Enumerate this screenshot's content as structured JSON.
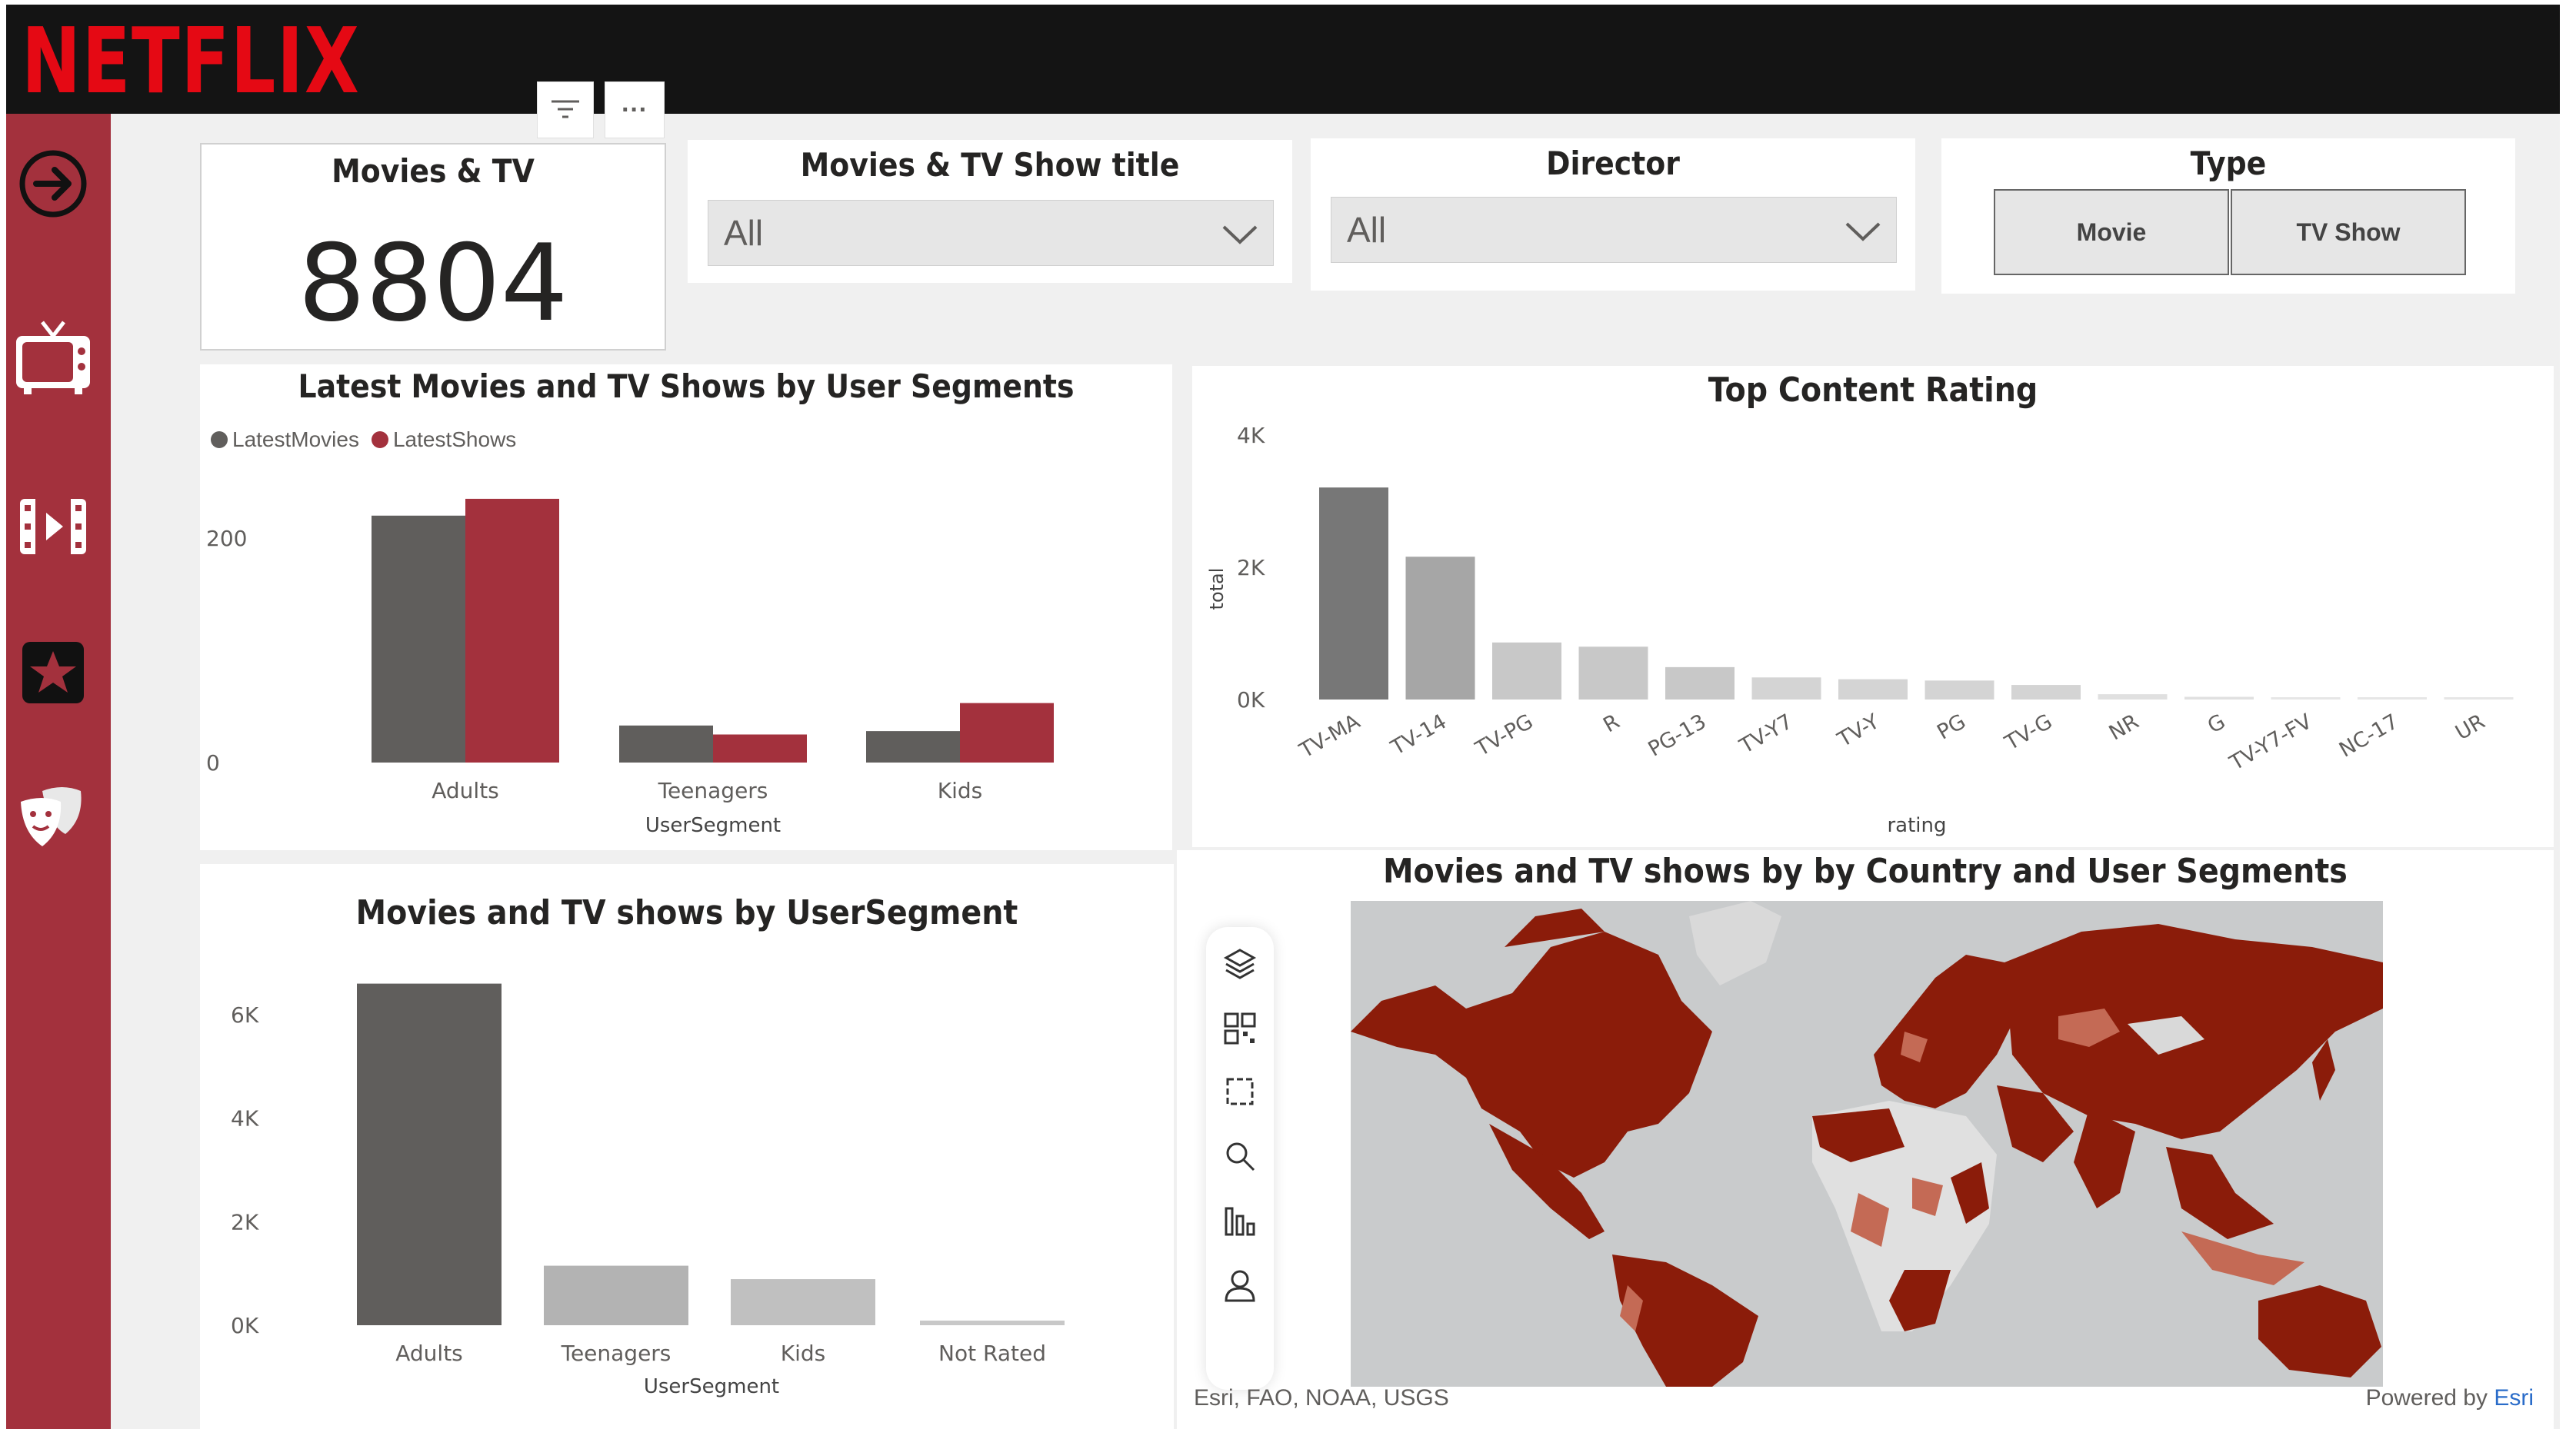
{
  "brand": {
    "logo_text": "NETFLIX",
    "accent": "#a3313d",
    "logo_color": "#e50914"
  },
  "sidebar": {
    "items": [
      {
        "name": "navigate-arrow-icon"
      },
      {
        "name": "tv-icon"
      },
      {
        "name": "film-icon"
      },
      {
        "name": "star-icon"
      },
      {
        "name": "theater-masks-icon"
      }
    ]
  },
  "kpi": {
    "title": "Movies & TV",
    "value": "8804"
  },
  "visual_header": {
    "filter_icon": "filter-icon",
    "more_label": "···"
  },
  "slicers": {
    "title": {
      "label": "Movies & TV Show title",
      "value": "All"
    },
    "director": {
      "label": "Director",
      "value": "All"
    },
    "type": {
      "label": "Type",
      "options": [
        "Movie",
        "TV Show"
      ]
    }
  },
  "chart_latest": {
    "title": "Latest Movies and TV Shows by User Segments",
    "legend": [
      "LatestMovies",
      "LatestShows"
    ]
  },
  "chart_rating": {
    "title": "Top Content Rating"
  },
  "chart_segment": {
    "title": "Movies and TV shows by UserSegment"
  },
  "map": {
    "title": "Movies and TV shows by by Country and User Segments",
    "attribution": "Esri, FAO, NOAA, USGS",
    "powered_prefix": "Powered by ",
    "powered_brand": "Esri",
    "tools": [
      "layers-icon",
      "qr-code-icon",
      "select-area-icon",
      "search-icon",
      "bar-chart-icon",
      "person-icon"
    ]
  },
  "chart_data": [
    {
      "type": "bar",
      "title": "Latest Movies and TV Shows by User Segments",
      "xlabel": "UserSegment",
      "ylabel": "",
      "categories": [
        "Adults",
        "Teenagers",
        "Kids"
      ],
      "series": [
        {
          "name": "LatestMovies",
          "values": [
            220,
            33,
            28
          ],
          "color": "#605e5c"
        },
        {
          "name": "LatestShows",
          "values": [
            235,
            25,
            53
          ],
          "color": "#a3313d"
        }
      ],
      "ylim": [
        0,
        300
      ],
      "yticks": [
        0,
        200
      ],
      "ytick_labels": [
        "0",
        "200"
      ],
      "legend_position": "top-left",
      "grid": false
    },
    {
      "type": "bar",
      "title": "Top Content Rating",
      "xlabel": "rating",
      "ylabel": "total",
      "categories": [
        "TV-MA",
        "TV-14",
        "TV-PG",
        "R",
        "PG-13",
        "TV-Y7",
        "TV-Y",
        "PG",
        "TV-G",
        "NR",
        "G",
        "TV-Y7-FV",
        "NC-17",
        "UR"
      ],
      "values": [
        3207,
        2160,
        863,
        799,
        490,
        334,
        307,
        287,
        220,
        80,
        41,
        6,
        3,
        3
      ],
      "colors": [
        "#777777",
        "#a6a6a6",
        "#c8c8c8",
        "#c8c8c8",
        "#c8c8c8",
        "#d4d4d4",
        "#d4d4d4",
        "#d4d4d4",
        "#d4d4d4",
        "#e0e0e0",
        "#e0e0e0",
        "#e6e6e6",
        "#e6e6e6",
        "#e6e6e6"
      ],
      "ylim": [
        0,
        4000
      ],
      "yticks": [
        0,
        2000,
        4000
      ],
      "ytick_labels": [
        "0K",
        "2K",
        "4K"
      ],
      "grid": false
    },
    {
      "type": "bar",
      "title": "Movies and TV shows by UserSegment",
      "xlabel": "UserSegment",
      "ylabel": "",
      "categories": [
        "Adults",
        "Teenagers",
        "Kids",
        "Not Rated"
      ],
      "values": [
        6600,
        1150,
        890,
        90
      ],
      "colors": [
        "#605e5c",
        "#b3b3b3",
        "#c0c0c0",
        "#c8c8c8"
      ],
      "ylim": [
        0,
        7000
      ],
      "yticks": [
        0,
        2000,
        4000,
        6000
      ],
      "ytick_labels": [
        "0K",
        "2K",
        "4K",
        "6K"
      ],
      "grid": false
    }
  ]
}
